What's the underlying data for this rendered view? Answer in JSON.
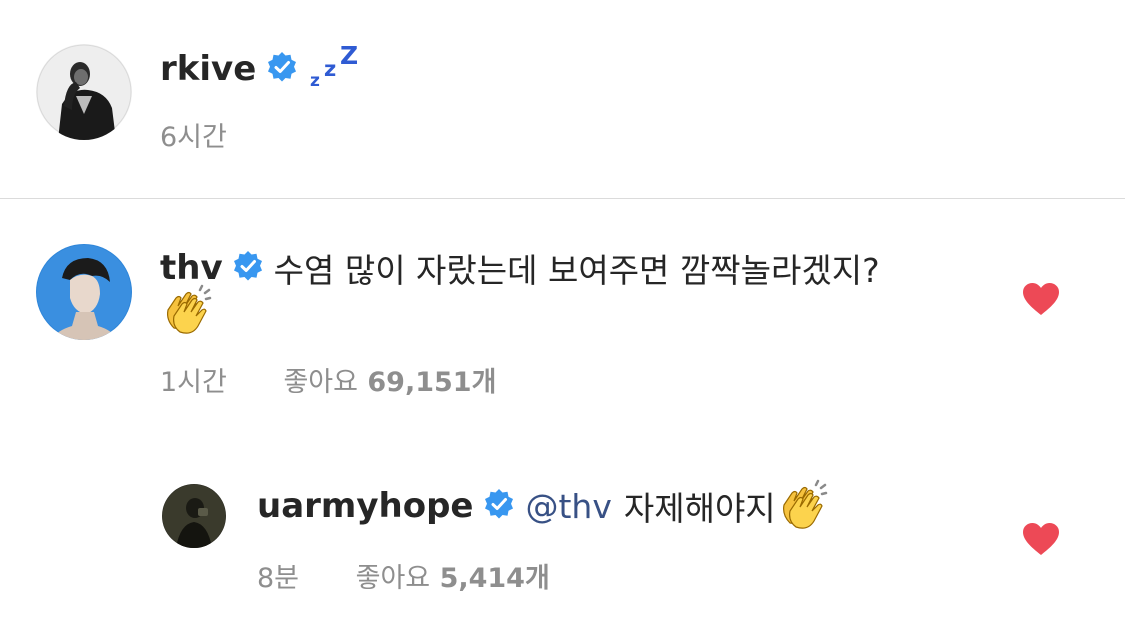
{
  "caption": {
    "username": "rkive",
    "verified": true,
    "emoji": "zzz-icon",
    "time": "6시간"
  },
  "comment": {
    "username": "thv",
    "verified": true,
    "text": "수염 많이 자랐는데 보여주면 깜짝놀라겠지?",
    "emoji": "clapping-hands-icon",
    "time": "1시간",
    "likes_label": "좋아요",
    "likes_count": "69,151개",
    "liked": true
  },
  "reply": {
    "username": "uarmyhope",
    "verified": true,
    "mention": "@thv",
    "text": "자제해야지",
    "emoji": "clapping-hands-icon",
    "time": "8분",
    "likes_label": "좋아요",
    "likes_count": "5,414개",
    "liked": true
  },
  "colors": {
    "verified_blue": "#3897f0",
    "heart_red": "#ed4956",
    "muted_gray": "#8e8e8e",
    "mention_blue": "#385185",
    "zzz_blue": "#2f5bd3"
  }
}
